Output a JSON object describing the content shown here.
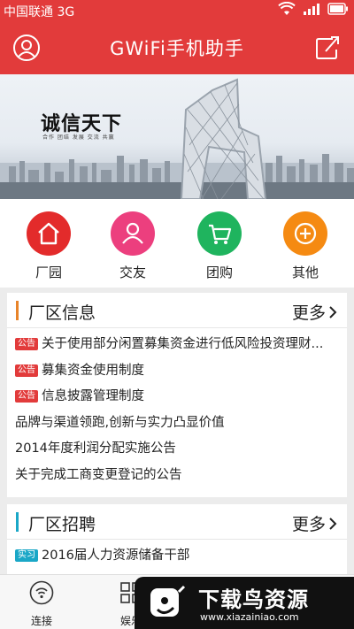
{
  "status": {
    "carrier": "中国联通 3G"
  },
  "header": {
    "title": "GWiFi手机助手",
    "left_icon": "user-icon",
    "right_icon": "share-icon"
  },
  "banner": {
    "slogan": "诚信天下",
    "subtitle": "合作 团结 发展 交流 共赢"
  },
  "categories": [
    {
      "label": "厂园",
      "icon": "home-icon",
      "color": "#e32b2b"
    },
    {
      "label": "交友",
      "icon": "people-icon",
      "color": "#ec3f7e"
    },
    {
      "label": "团购",
      "icon": "cart-icon",
      "color": "#1fb45e"
    },
    {
      "label": "其他",
      "icon": "plus-icon",
      "color": "#f58a12"
    }
  ],
  "news": {
    "title": "厂区信息",
    "more": "更多",
    "accent": "#e8842a",
    "items": [
      {
        "tag": "公告",
        "text": "关于使用部分闲置募集资金进行低风险投资理财..."
      },
      {
        "tag": "公告",
        "text": "募集资金使用制度"
      },
      {
        "tag": "公告",
        "text": "信息披露管理制度"
      },
      {
        "tag": "",
        "text": "品牌与渠道领跑,创新与实力凸显价值"
      },
      {
        "tag": "",
        "text": "2014年度利润分配实施公告"
      },
      {
        "tag": "",
        "text": "关于完成工商变更登记的公告"
      }
    ]
  },
  "jobs": {
    "title": "厂区招聘",
    "more": "更多",
    "accent": "#1aa7c7",
    "items": [
      {
        "tag": "实习",
        "text": "2016届人力资源储备干部"
      }
    ]
  },
  "bottom_nav": [
    {
      "label": "连接",
      "icon": "wifi-icon"
    },
    {
      "label": "娱乐",
      "icon": "grid-icon"
    }
  ],
  "watermark": {
    "title": "下载鸟资源",
    "url": "www.xiazainiao.com"
  },
  "colors": {
    "primary": "#e23b3b"
  }
}
